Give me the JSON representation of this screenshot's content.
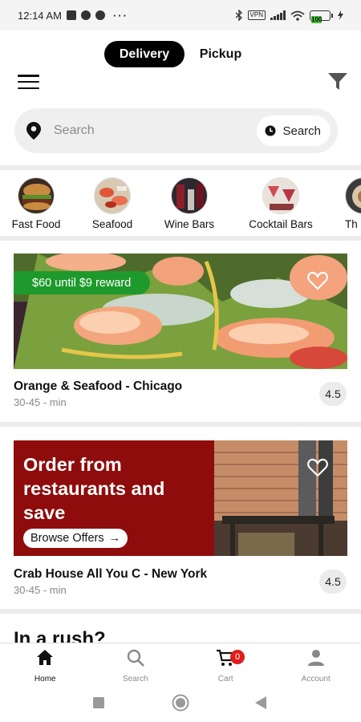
{
  "status_bar": {
    "time": "12:14 AM",
    "dots": "···",
    "vpn": "VPN",
    "battery": "100"
  },
  "mode_toggle": {
    "active": "Delivery",
    "inactive": "Pickup"
  },
  "search": {
    "placeholder": "Search",
    "schedule_label": "Search"
  },
  "categories": [
    {
      "label": "Fast Food",
      "icon": "burger-photo"
    },
    {
      "label": "Seafood",
      "icon": "seafood-photo"
    },
    {
      "label": "Wine Bars",
      "icon": "wine-bar-photo"
    },
    {
      "label": "Cocktail Bars",
      "icon": "cocktail-photo"
    },
    {
      "label": "Th",
      "icon": "food-photo"
    }
  ],
  "restaurants": [
    {
      "reward": "$60 until $9 reward",
      "name": "Orange & Seafood - Chicago",
      "time": "30-45 - min",
      "rating": "4.5"
    },
    {
      "promo_title": "Order from restaurants and save",
      "promo_cta": "Browse Offers",
      "promo_cta_arrow": "→",
      "name": "Crab House All You C - New York",
      "time": "30-45 - min",
      "rating": "4.5"
    }
  ],
  "section_peek": "In a rush?",
  "bottom_nav": [
    {
      "label": "Home",
      "icon": "home-icon",
      "active": true
    },
    {
      "label": "Search",
      "icon": "search-icon",
      "active": false
    },
    {
      "label": "Cart",
      "icon": "cart-icon",
      "active": false,
      "badge": "0"
    },
    {
      "label": "Account",
      "icon": "account-icon",
      "active": false
    }
  ],
  "colors": {
    "reward_green": "#1e9a2c",
    "promo_red": "#8e0c0c",
    "cart_badge": "#e21b1b",
    "toggle_active": "#000000"
  }
}
